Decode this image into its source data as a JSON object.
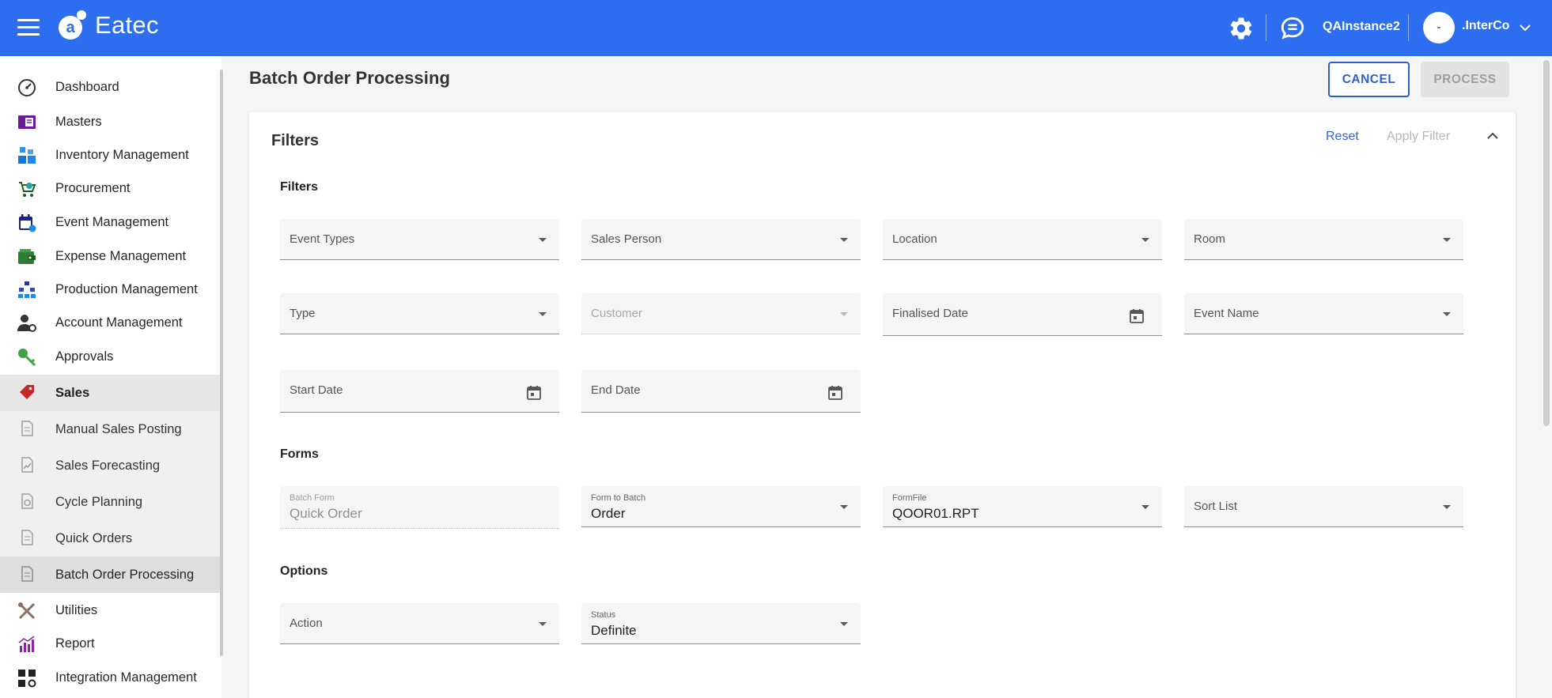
{
  "app": {
    "brand": "Eatec",
    "instance": "QAInstance2",
    "avatar_initial": "-",
    "user": ".InterCo"
  },
  "colors": {
    "primary": "#2d6ef0",
    "accent": "#2d5fcf",
    "surface": "#ffffff",
    "sales_icon": "#c62828"
  },
  "sidebar": {
    "items": [
      {
        "label": "Dashboard",
        "icon": "dashboard-gauge-icon"
      },
      {
        "label": "Masters",
        "icon": "masters-book-icon"
      },
      {
        "label": "Inventory Management",
        "icon": "inventory-boxes-icon"
      },
      {
        "label": "Procurement",
        "icon": "procurement-cart-icon"
      },
      {
        "label": "Event Management",
        "icon": "event-calendar-icon"
      },
      {
        "label": "Expense Management",
        "icon": "expense-wallet-icon"
      },
      {
        "label": "Production Management",
        "icon": "production-hierarchy-icon"
      },
      {
        "label": "Account Management",
        "icon": "account-user-gear-icon"
      },
      {
        "label": "Approvals",
        "icon": "approvals-key-icon"
      },
      {
        "label": "Sales",
        "icon": "sales-tag-icon"
      },
      {
        "label": "Manual Sales Posting",
        "icon": "document-icon"
      },
      {
        "label": "Sales Forecasting",
        "icon": "document-chart-icon"
      },
      {
        "label": "Cycle Planning",
        "icon": "document-cycle-icon"
      },
      {
        "label": "Quick Orders",
        "icon": "document-icon"
      },
      {
        "label": "Batch Order Processing",
        "icon": "document-icon"
      },
      {
        "label": "Utilities",
        "icon": "utilities-tools-icon"
      },
      {
        "label": "Report",
        "icon": "report-chart-icon"
      },
      {
        "label": "Integration Management",
        "icon": "integration-grid-icon"
      }
    ]
  },
  "page": {
    "title": "Batch Order Processing",
    "cancel_label": "CANCEL",
    "process_label": "PROCESS"
  },
  "card": {
    "title": "Filters",
    "reset_label": "Reset",
    "apply_filter_label": "Apply Filter",
    "filters_section": "Filters",
    "forms_section": "Forms",
    "options_section": "Options",
    "filters": {
      "event_types": "Event Types",
      "sales_person": "Sales Person",
      "location": "Location",
      "room": "Room",
      "type": "Type",
      "customer": "Customer",
      "finalised_date": "Finalised Date",
      "event_name": "Event Name",
      "start_date": "Start Date",
      "end_date": "End Date"
    },
    "forms": {
      "batch_form_label": "Batch Form",
      "batch_form_value": "Quick Order",
      "form_to_batch_label": "Form to Batch",
      "form_to_batch_value": "Order",
      "formfile_label": "FormFile",
      "formfile_value": "QOOR01.RPT",
      "sort_list_label": "Sort List"
    },
    "options": {
      "action_label": "Action",
      "status_label": "Status",
      "status_value": "Definite"
    }
  }
}
